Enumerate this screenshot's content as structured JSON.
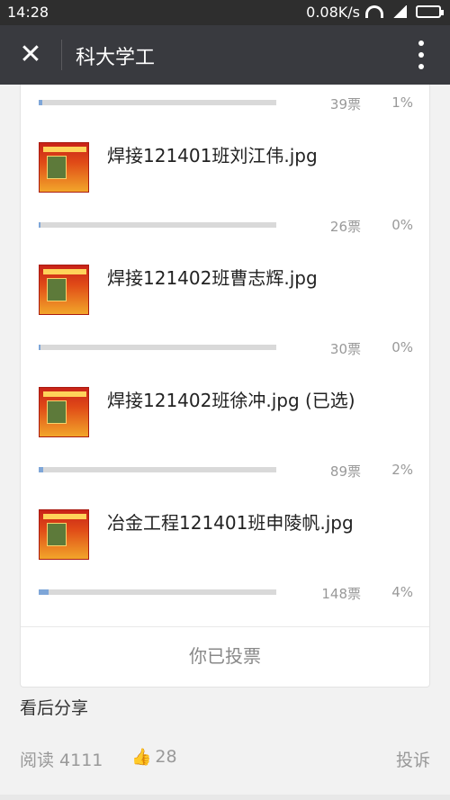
{
  "statusbar": {
    "time": "14:28",
    "network": "0.08K/s"
  },
  "navbar": {
    "close_label": "✕",
    "title": "科大学工"
  },
  "poll": {
    "top_item": {
      "votes": "39票",
      "percent": "1%",
      "fill": 0.01
    },
    "items": [
      {
        "name": "焊接121401班刘江伟.jpg",
        "votes": "26票",
        "percent": "0%",
        "fill": 0.0
      },
      {
        "name": "焊接121402班曹志辉.jpg",
        "votes": "30票",
        "percent": "0%",
        "fill": 0.0
      },
      {
        "name": "焊接121402班徐冲.jpg (已选)",
        "votes": "89票",
        "percent": "2%",
        "fill": 0.02
      },
      {
        "name": "冶金工程121401班申陵帆.jpg",
        "votes": "148票",
        "percent": "4%",
        "fill": 0.04
      }
    ],
    "voted_label": "你已投票"
  },
  "share_label": "看后分享",
  "footer": {
    "read": "阅读 4111",
    "likes": "28",
    "report": "投诉"
  },
  "colors": {
    "navbar": "#393a3f",
    "bar_fill": "#7ea6d8",
    "like": "#576b95"
  }
}
